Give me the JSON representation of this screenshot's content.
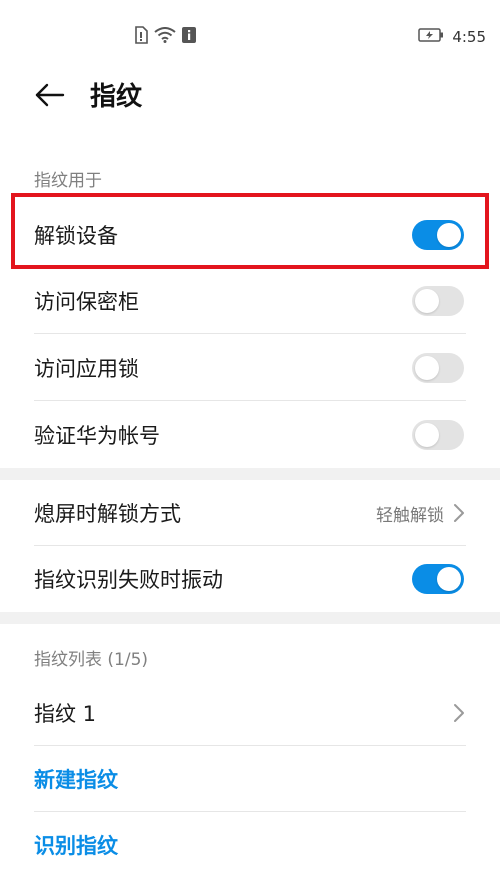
{
  "status_bar": {
    "icons": [
      "sim-card-icon",
      "wifi-icon",
      "nfc-icon"
    ],
    "battery_icon": "battery-charging-icon",
    "time": "4:55"
  },
  "header": {
    "back_icon": "arrow-left-icon",
    "title": "指纹"
  },
  "section_usage": {
    "label": "指纹用于",
    "items": [
      {
        "label": "解锁设备",
        "toggle": true
      },
      {
        "label": "访问保密柜",
        "toggle": false
      },
      {
        "label": "访问应用锁",
        "toggle": false
      },
      {
        "label": "验证华为帐号",
        "toggle": false
      }
    ]
  },
  "section_settings": {
    "items": [
      {
        "label": "熄屏时解锁方式",
        "value": "轻触解锁"
      },
      {
        "label": "指纹识别失败时振动",
        "toggle": true
      }
    ]
  },
  "section_list": {
    "label": "指纹列表 (1/5)",
    "items": [
      {
        "label": "指纹 1"
      }
    ],
    "actions": [
      {
        "label": "新建指纹"
      },
      {
        "label": "识别指纹"
      }
    ]
  },
  "colors": {
    "accent": "#0a8de6",
    "highlight": "#e3151d",
    "toggle_off": "#e3e3e3"
  }
}
